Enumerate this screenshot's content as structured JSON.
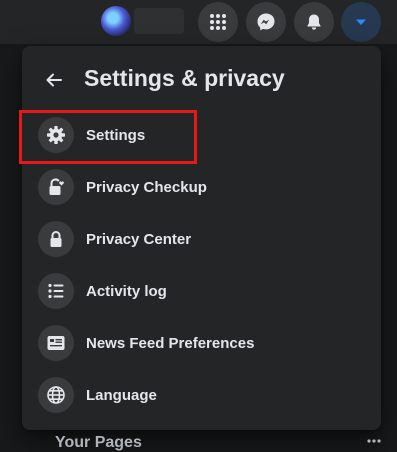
{
  "topbar": {
    "icons": [
      "menu-grid-icon",
      "messenger-icon",
      "bell-icon",
      "caret-down-icon"
    ],
    "accent_color": "#2d88ff"
  },
  "panel": {
    "title": "Settings & privacy",
    "back_icon": "arrow-left-icon",
    "items": [
      {
        "label": "Settings",
        "icon": "gear-icon"
      },
      {
        "label": "Privacy Checkup",
        "icon": "lock-heart-icon"
      },
      {
        "label": "Privacy Center",
        "icon": "lock-icon"
      },
      {
        "label": "Activity log",
        "icon": "list-icon"
      },
      {
        "label": "News Feed Preferences",
        "icon": "news-feed-icon"
      },
      {
        "label": "Language",
        "icon": "globe-icon"
      }
    ],
    "highlight_color": "#e8171a"
  },
  "footer": {
    "section_title": "Your Pages",
    "more_icon": "more-horizontal-icon"
  }
}
